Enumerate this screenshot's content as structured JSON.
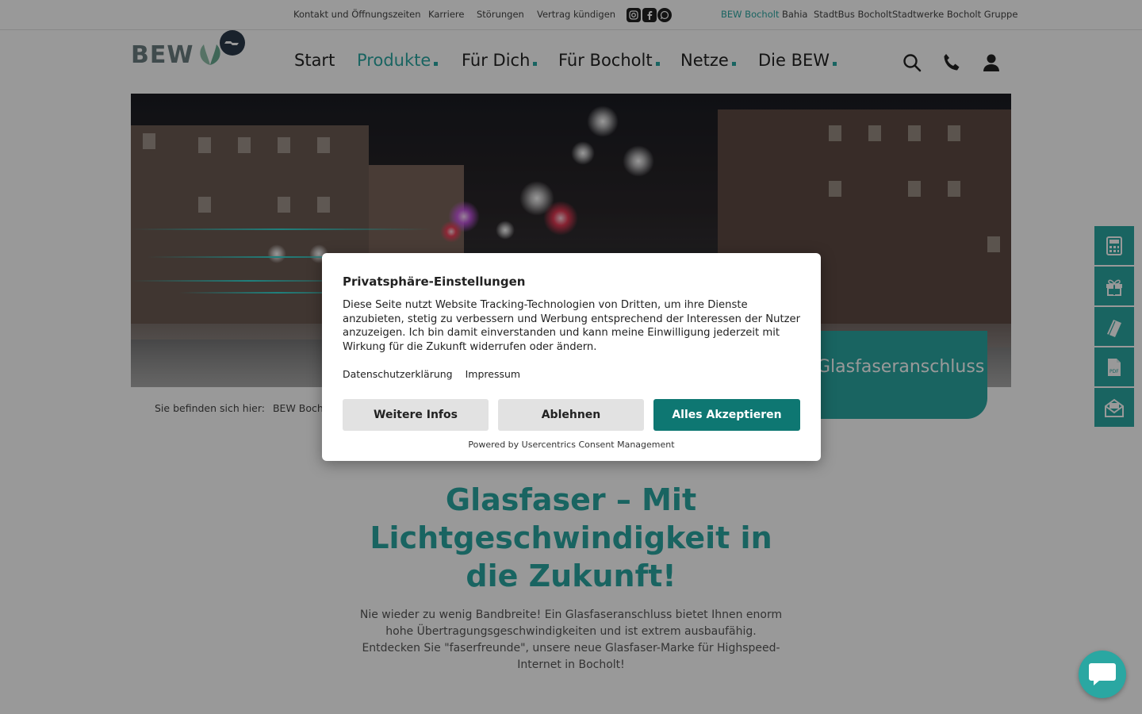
{
  "topbar": {
    "links": [
      "Kontakt und Öffnungszeiten",
      "Karriere",
      "Störungen",
      "Vertrag kündigen"
    ],
    "social": [
      "instagram-icon",
      "facebook-icon",
      "whatsapp-icon"
    ],
    "group_links": [
      "BEW Bocholt",
      "Bahia",
      "StadtBus Bocholt",
      "Stadtwerke Bocholt Gruppe"
    ],
    "active_group": "BEW Bocholt"
  },
  "logo": {
    "text": "BEW"
  },
  "nav": {
    "items": [
      "Start",
      "Produkte",
      "Für Dich",
      "Für Bocholt",
      "Netze",
      "Die BEW"
    ],
    "active": "Produkte"
  },
  "header_icons": [
    "search-icon",
    "phone-icon",
    "user-icon"
  ],
  "hero": {
    "teaser_text": "Glasfaseranschluss"
  },
  "breadcrumb": {
    "label": "Sie befinden sich hier:",
    "current": "BEW Bocholt"
  },
  "main": {
    "title": "Glasfaser – Mit Lichtgeschwindigkeit in die Zukunft!",
    "text": "Nie wieder zu wenig Bandbreite! Ein Glasfaseranschluss bietet Ihnen enorm hohe Übertragungsgeschwindigkeiten und ist extrem ausbaufähig. Entdecken Sie \"faserfreunde\", unsere neue Glasfaser-Marke für Highspeed-Internet in Bocholt!"
  },
  "side_tools": [
    "calculator-icon",
    "gift-icon",
    "brochure-icon",
    "pdf-icon",
    "mail-icon"
  ],
  "consent": {
    "title": "Privatsphäre-Einstellungen",
    "text": "Diese Seite nutzt Website Tracking-Technologien von Dritten, um ihre Dienste anzubieten, stetig zu verbessern und Werbung entsprechend der Interessen der Nutzer anzuzeigen. Ich bin damit einverstanden und kann meine Einwilligung jederzeit mit Wirkung für die Zukunft widerrufen oder ändern.",
    "links": [
      "Datenschutzerklärung",
      "Impressum"
    ],
    "buttons": {
      "more": "Weitere Infos",
      "deny": "Ablehnen",
      "accept": "Alles Akzeptieren"
    },
    "powered_by": "Powered by Usercentrics Consent Management"
  },
  "colors": {
    "accent": "#2aa7a2",
    "accept_button": "#0e7772",
    "overlay": "rgba(0,0,0,0.40)"
  }
}
